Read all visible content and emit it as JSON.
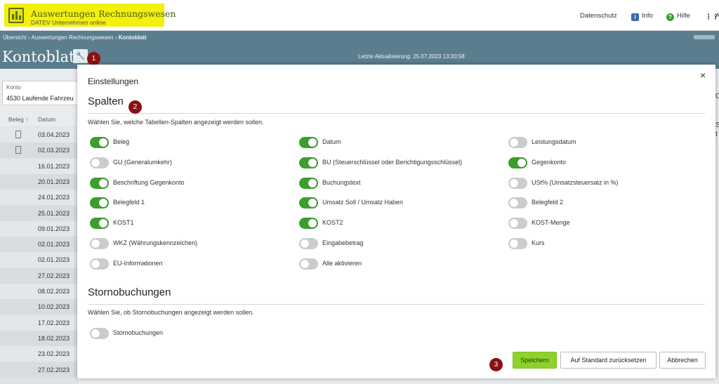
{
  "header": {
    "app_title": "Auswertungen Rechnungswesen",
    "app_subtitle": "DATEV Unternehmen online",
    "nav": [
      {
        "label": "Datenschutz",
        "icon": "none"
      },
      {
        "label": "Info",
        "icon": "info-icon"
      },
      {
        "label": "Hilfe",
        "icon": "help-icon"
      },
      {
        "label": "A",
        "icon": "apps-grid-icon"
      }
    ]
  },
  "breadcrumb": {
    "items": [
      "Übersicht",
      "Auswertungen Rechnungswesen",
      "Kontoblatt"
    ],
    "separator": "›"
  },
  "page": {
    "title": "Kontoblatt",
    "last_update": "Letzte Aktualisierung: 25.07.2023 13:20:58"
  },
  "konto": {
    "label": "Konto",
    "value": "4530 Laufende Fahrzeu"
  },
  "table": {
    "headers": {
      "beleg": "Beleg ↑",
      "datum": "Datum"
    },
    "rows": [
      "03.04.2023",
      "02.03.2023",
      "16.01.2023",
      "20.01.2023",
      "24.01.2023",
      "25.01.2023",
      "09.01.2023",
      "02.01.2023",
      "02.01.2023",
      "27.02.2023",
      "08.02.2023",
      "10.02.2023",
      "17.02.2023",
      "18.02.2023",
      "23.02.2023",
      "27.02.2023"
    ],
    "rows_with_doc_icon": [
      0,
      1
    ]
  },
  "right_edge_fragments": [
    "C",
    "S",
    "t"
  ],
  "annotations": [
    "1",
    "2",
    "3"
  ],
  "modal": {
    "title": "Einstellungen",
    "close": "×",
    "spalten": {
      "heading": "Spalten",
      "description": "Wählen Sie, welche Tabellen-Spalten angezeigt werden sollen.",
      "options": [
        [
          {
            "label": "Beleg",
            "on": true
          },
          {
            "label": "GU (Generalumkehr)",
            "on": false
          },
          {
            "label": "Beschriftung Gegenkonto",
            "on": true
          },
          {
            "label": "Belegfeld 1",
            "on": true
          },
          {
            "label": "KOST1",
            "on": true
          },
          {
            "label": "WKZ (Währungskennzeichen)",
            "on": false
          },
          {
            "label": "EU-Informationen",
            "on": false
          }
        ],
        [
          {
            "label": "Datum",
            "on": true
          },
          {
            "label": "BU (Steuerschlüssel oder Berichtigungsschlüssel)",
            "on": true
          },
          {
            "label": "Buchungstext",
            "on": true
          },
          {
            "label": "Umsatz Soll / Umsatz Haben",
            "on": true
          },
          {
            "label": "KOST2",
            "on": true
          },
          {
            "label": "Eingabebetrag",
            "on": false
          },
          {
            "label": "Alle aktivieren",
            "on": false
          }
        ],
        [
          {
            "label": "Leistungsdatum",
            "on": false
          },
          {
            "label": "Gegenkonto",
            "on": true
          },
          {
            "label": "USt% (Umsatzsteuersatz in %)",
            "on": false
          },
          {
            "label": "Belegfeld 2",
            "on": false
          },
          {
            "label": "KOST-Menge",
            "on": false
          },
          {
            "label": "Kurs",
            "on": false
          }
        ]
      ]
    },
    "storno": {
      "heading": "Stornobuchungen",
      "description": "Wählen Sie, ob Stornobuchungen angezeigt werden sollen.",
      "option": {
        "label": "Stornobuchungen",
        "on": false
      }
    },
    "buttons": {
      "save": "Speichern",
      "reset": "Auf Standard zurücksetzen",
      "cancel": "Abbrechen"
    }
  },
  "colors": {
    "brand_yellow": "#f2f00c",
    "header_bar": "#5b7e8e",
    "toggle_on": "#3b9e2d",
    "toggle_off": "#c9cdd0",
    "save_button": "#8ed12a",
    "annotation_badge": "#8b1014"
  }
}
